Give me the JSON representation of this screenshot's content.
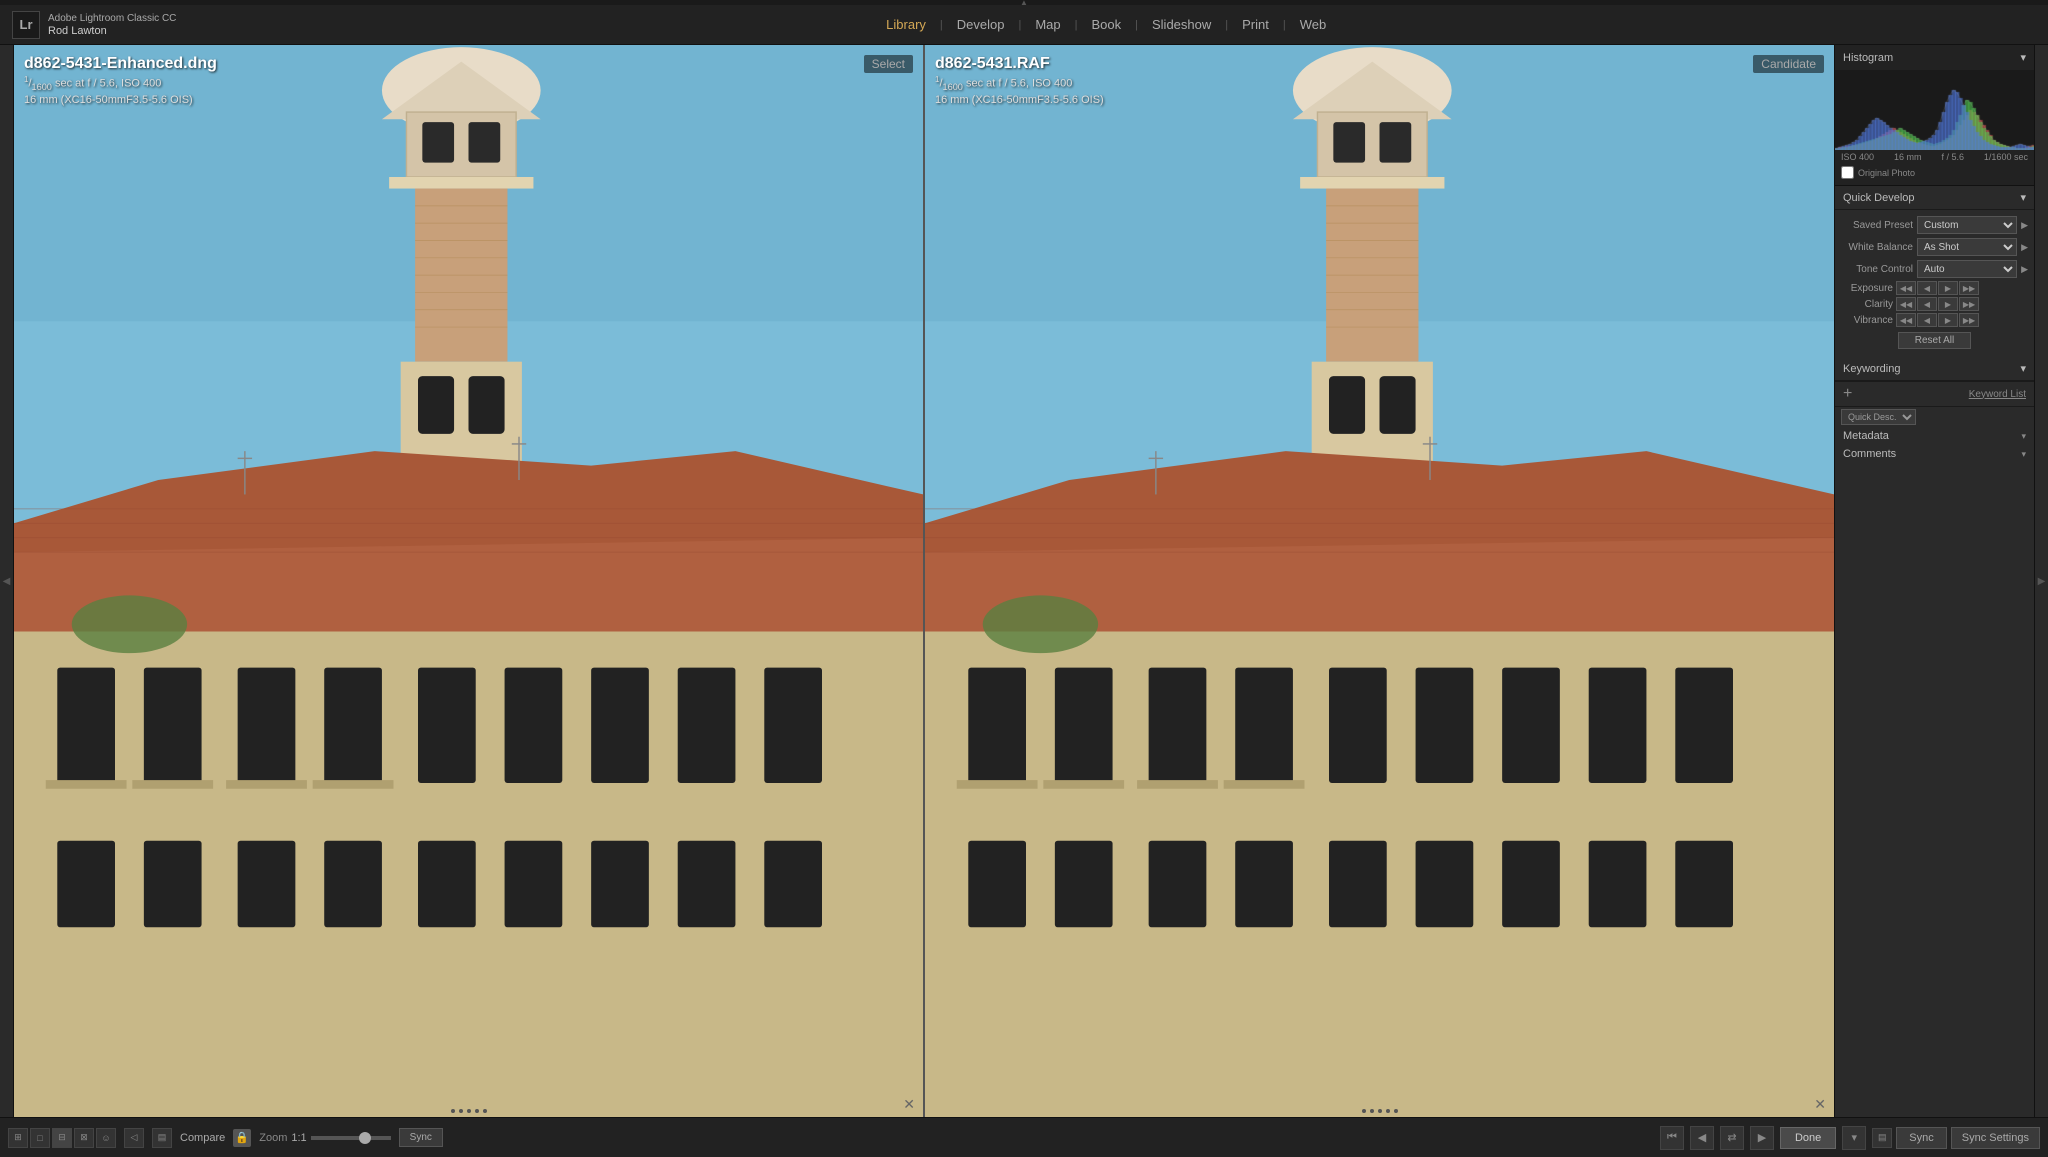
{
  "app": {
    "logo": "Lr",
    "name": "Adobe Lightroom Classic CC",
    "user": "Rod Lawton"
  },
  "nav": {
    "items": [
      {
        "id": "library",
        "label": "Library",
        "active": true
      },
      {
        "id": "develop",
        "label": "Develop",
        "active": false
      },
      {
        "id": "map",
        "label": "Map",
        "active": false
      },
      {
        "id": "book",
        "label": "Book",
        "active": false
      },
      {
        "id": "slideshow",
        "label": "Slideshow",
        "active": false
      },
      {
        "id": "print",
        "label": "Print",
        "active": false
      },
      {
        "id": "web",
        "label": "Web",
        "active": false
      }
    ]
  },
  "compare": {
    "left": {
      "label": "Select",
      "filename": "d862-5431-Enhanced.dng",
      "shutter_num": "1",
      "shutter_den": "1600",
      "aperture": "f / 5.6",
      "iso": "ISO 400",
      "lens": "16 mm (XC16-50mmF3.5-5.6 OIS)"
    },
    "right": {
      "label": "Candidate",
      "filename": "d862-5431.RAF",
      "shutter_num": "1",
      "shutter_den": "1600",
      "aperture": "f / 5.6",
      "iso": "ISO 400",
      "lens": "16 mm (XC16-50mmF3.5-5.6 OIS)"
    }
  },
  "histogram": {
    "title": "Histogram",
    "meta_iso": "ISO 400",
    "meta_focal": "16 mm",
    "meta_aperture": "f / 5.6",
    "meta_shutter": "1/1600 sec",
    "original_photo_label": "Original Photo"
  },
  "quick_develop": {
    "title": "Quick Develop",
    "saved_preset_label": "Saved Preset",
    "saved_preset_value": "Custom",
    "white_balance_label": "White Balance",
    "white_balance_value": "As Shot",
    "tone_control_label": "Tone Control",
    "tone_control_value": "Auto",
    "exposure_label": "Exposure",
    "clarity_label": "Clarity",
    "vibrance_label": "Vibrance",
    "reset_btn": "Reset All",
    "btn_dbl_left": "◀◀",
    "btn_left": "◀",
    "btn_right": "▶",
    "btn_dbl_right": "▶▶"
  },
  "keywording": {
    "title": "Keywording",
    "keyword_list_label": "Keyword List",
    "metadata_label": "Metadata",
    "comments_label": "Comments",
    "quick_desc_label": "Quick Desc."
  },
  "toolbar": {
    "compare_label": "Compare",
    "zoom_label": "Zoom",
    "zoom_value": "1:1",
    "sync_label": "Sync",
    "done_label": "Done",
    "sync_bottom": "Sync",
    "sync_settings": "Sync Settings",
    "icons": {
      "grid": "⊞",
      "loupe": "□",
      "compare": "⊟",
      "survey": "⊠",
      "filmstrip": "▤",
      "lock": "🔒"
    }
  }
}
